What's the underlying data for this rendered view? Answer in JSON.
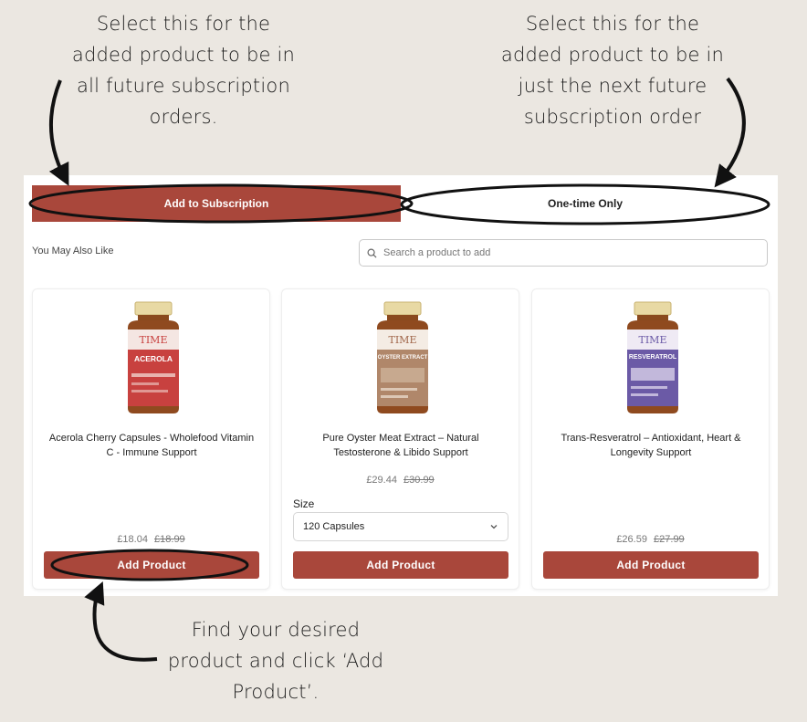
{
  "annotations": {
    "left": [
      "Select this for the",
      "added product to be in",
      "all future subscription",
      "orders."
    ],
    "right": [
      "Select this for the",
      "added product to be in",
      "just the next future",
      "subscription order"
    ],
    "bottom": [
      "Find your desired",
      "product and click  ‘Add",
      "Product’."
    ]
  },
  "tabs": {
    "subscription": "Add to Subscription",
    "one_time": "One-time Only"
  },
  "section_title": "You May Also Like",
  "search": {
    "placeholder": "Search a product to add",
    "icon": "search-icon"
  },
  "products": [
    {
      "name": "Acerola Cherry Capsules - Wholefood Vitamin C - Immune Support",
      "price": "£18.04",
      "old_price": "£18.99",
      "button": "Add Product",
      "bottle_brand": "TIME",
      "bottle_label": "ACEROLA",
      "label_color": "#c8413f"
    },
    {
      "name": "Pure Oyster Meat Extract – Natural Testosterone & Libido Support",
      "price": "£29.44",
      "old_price": "£30.99",
      "size_label": "Size",
      "size_value": "120 Capsules",
      "button": "Add Product",
      "bottle_brand": "TIME",
      "bottle_label": "OYSTER EXTRACT",
      "label_color": "#b0876a"
    },
    {
      "name": "Trans-Resveratrol – Antioxidant, Heart & Longevity Support",
      "price": "£26.59",
      "old_price": "£27.99",
      "button": "Add Product",
      "bottle_brand": "TIME",
      "bottle_label": "RESVERATROL",
      "label_color": "#6b5aa6"
    }
  ],
  "colors": {
    "accent": "#a9473b",
    "background": "#ebe7e1"
  }
}
